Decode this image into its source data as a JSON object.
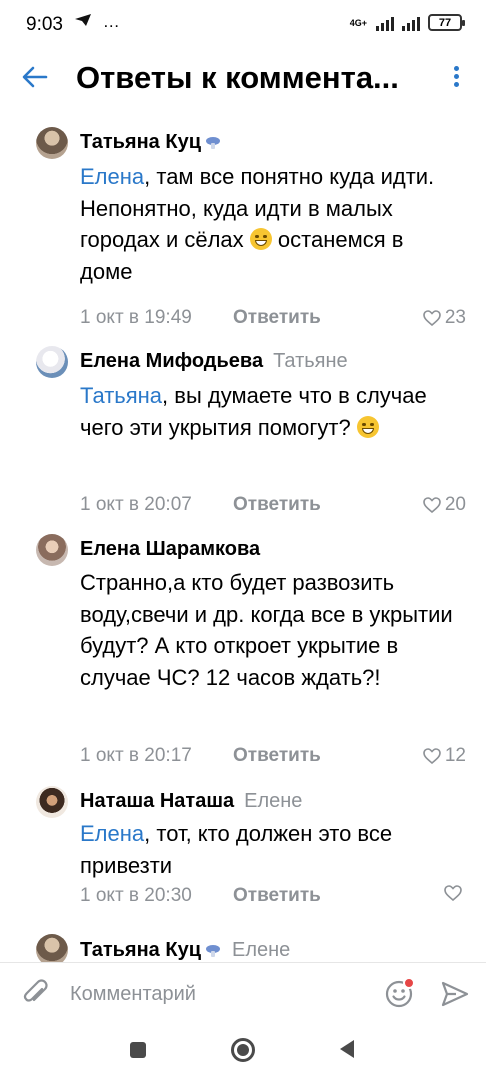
{
  "status_bar": {
    "time": "9:03",
    "telegram_icon": "telegram-send-icon",
    "more_icon": "…",
    "network": "4G+",
    "battery": "77"
  },
  "header": {
    "title": "Ответы к коммента...",
    "back_icon": "arrow-left-icon",
    "menu_icon": "vertical-dots-icon"
  },
  "comments": [
    {
      "author": "Татьяна Куц",
      "reply_to": "",
      "mention": "Елена",
      "text": ", там все понятно куда идти. Непонятно, куда идти в малых городах и сёлах ",
      "emoji": "rolling-laughing-emoji",
      "text_after": " останемся в доме",
      "date": "1 окт в 19:49",
      "reply_label": "Ответить",
      "likes": "23"
    },
    {
      "author": "Елена Мифодьева",
      "reply_to": "Татьяне",
      "mention": "Татьяна",
      "text": ", вы думаете что в случае чего эти укрытия помогут? ",
      "emoji": "grinning-emoji",
      "text_after": "",
      "date": "1 окт в 20:07",
      "reply_label": "Ответить",
      "likes": "20"
    },
    {
      "author": "Елена Шарамкова",
      "reply_to": "",
      "mention": "",
      "text": "Странно,а кто будет развозить воду,свечи и др. когда все в укрытии будут?  А кто откроет укрытие в случае ЧС? 12 часов ждать?!",
      "emoji": "",
      "text_after": "",
      "date": "1 окт в 20:17",
      "reply_label": "Ответить",
      "likes": "12"
    },
    {
      "author": "Наташа Наташа",
      "reply_to": "Елене",
      "mention": "Елена",
      "text": ", тот, кто должен это все привезти",
      "emoji": "",
      "text_after": "",
      "date": "1 окт в 20:30",
      "reply_label": "Ответить",
      "likes": ""
    },
    {
      "author": "Татьяна Куц",
      "reply_to": "Елене",
      "mention": "",
      "text": "",
      "emoji": "",
      "text_after": "",
      "date": "",
      "reply_label": "",
      "likes": ""
    }
  ],
  "input": {
    "placeholder": "Комментарий",
    "value": "",
    "attach_icon": "paperclip-icon",
    "emoji_icon": "smiley-icon",
    "send_icon": "send-arrow-icon"
  },
  "nav": {
    "recents_icon": "square-icon",
    "home_icon": "circle-icon",
    "back_icon": "triangle-back-icon"
  },
  "colors": {
    "accent": "#2a78c9",
    "secondary_text": "#8d9196",
    "notification_dot": "#e64646"
  }
}
